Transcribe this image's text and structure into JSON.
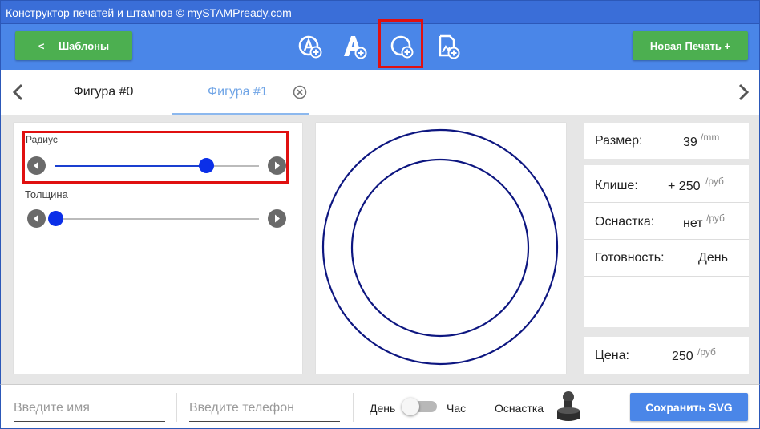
{
  "window": {
    "title": "Конструктор печатей и штампов © mySTAMPready.com"
  },
  "toolbar": {
    "templates_button": {
      "arrow": "<",
      "label": "Шаблоны"
    },
    "new_stamp_button": "Новая Печать +",
    "tools": [
      {
        "name": "add-circle-text-icon"
      },
      {
        "name": "add-text-icon"
      },
      {
        "name": "add-circle-icon",
        "highlighted": true
      },
      {
        "name": "add-image-icon"
      }
    ]
  },
  "tabs": {
    "items": [
      {
        "label": "Фигура #0",
        "active": false
      },
      {
        "label": "Фигура #1",
        "active": true
      }
    ]
  },
  "controls": {
    "radius": {
      "label": "Радиус",
      "value": 0.74
    },
    "thickness": {
      "label": "Толщина",
      "value": 0.0
    }
  },
  "info": {
    "size": {
      "label": "Размер:",
      "value": "39",
      "unit": "/mm"
    },
    "cliche": {
      "label": "Клише:",
      "value": "+ 250",
      "unit": "/руб"
    },
    "equipment": {
      "label": "Оснастка:",
      "value": "нет",
      "unit": "/руб"
    },
    "readiness": {
      "label": "Готовность:",
      "value": "День"
    },
    "price": {
      "label": "Цена:",
      "value": "250",
      "unit": "/руб"
    }
  },
  "bottom": {
    "name_placeholder": "Введите имя",
    "phone_placeholder": "Введите телефон",
    "toggle": {
      "left_label": "День",
      "right_label": "Час",
      "state": "День"
    },
    "equipment_label": "Оснастка",
    "save_button": "Сохранить SVG"
  },
  "colors": {
    "header": "#4a86e8",
    "green_button": "#4caf50",
    "stamp_stroke": "#0d1680",
    "slider": "#0b2fe8",
    "highlight": "#e01010"
  }
}
